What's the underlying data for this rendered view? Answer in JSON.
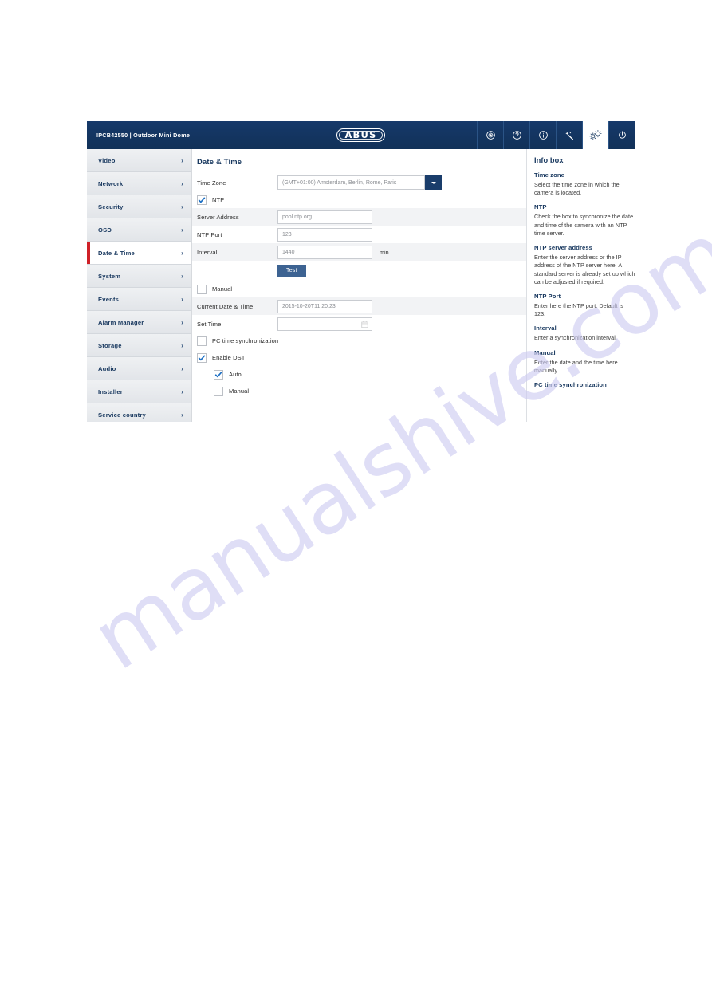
{
  "header": {
    "device_model": "IPCB42550",
    "device_name": "Outdoor Mini Dome",
    "device_title": "IPCB42550  |  Outdoor Mini Dome",
    "logo_text": "ABUS",
    "toolbar": [
      {
        "name": "live-view-icon",
        "label": "Live view"
      },
      {
        "name": "help-icon",
        "label": "Help"
      },
      {
        "name": "info-icon",
        "label": "Info"
      },
      {
        "name": "assistant-wand-icon",
        "label": "Assistant"
      },
      {
        "name": "settings-gear-icon",
        "label": "Settings",
        "active": true
      },
      {
        "name": "power-icon",
        "label": "Power"
      }
    ]
  },
  "sidebar": {
    "items": [
      {
        "label": "Video",
        "selected": false
      },
      {
        "label": "Network",
        "selected": false
      },
      {
        "label": "Security",
        "selected": false
      },
      {
        "label": "OSD",
        "selected": false
      },
      {
        "label": "Date & Time",
        "selected": true
      },
      {
        "label": "System",
        "selected": false
      },
      {
        "label": "Events",
        "selected": false
      },
      {
        "label": "Alarm Manager",
        "selected": false
      },
      {
        "label": "Storage",
        "selected": false
      },
      {
        "label": "Audio",
        "selected": false
      },
      {
        "label": "Installer",
        "selected": false
      },
      {
        "label": "Service country",
        "selected": false
      }
    ],
    "chevron": "›"
  },
  "main": {
    "page_title": "Date & Time",
    "time_zone": {
      "label": "Time Zone",
      "value": "(GMT+01:00) Amsterdam, Berlin, Rome, Paris"
    },
    "ntp_checkbox": {
      "label": "NTP",
      "checked": true
    },
    "server_address": {
      "label": "Server Address",
      "value": "pool.ntp.org"
    },
    "ntp_port": {
      "label": "NTP Port",
      "value": "123"
    },
    "interval": {
      "label": "Interval",
      "value": "1440",
      "unit": "min."
    },
    "test_button": {
      "label": "Test"
    },
    "manual_checkbox": {
      "label": "Manual",
      "checked": false
    },
    "current_date_time": {
      "label": "Current Date & Time",
      "value": "2015-10-20T11:20:23"
    },
    "set_time": {
      "label": "Set Time",
      "value": ""
    },
    "pc_time_sync": {
      "label": "PC time synchronization",
      "checked": false
    },
    "enable_dst": {
      "label": "Enable DST",
      "checked": true
    },
    "dst_auto": {
      "label": "Auto",
      "checked": true
    },
    "dst_manual": {
      "label": "Manual",
      "checked": false
    }
  },
  "infobox": {
    "title": "Info box",
    "sections": [
      {
        "heading": "Time zone",
        "text": "Select the time zone in which the camera is located."
      },
      {
        "heading": "NTP",
        "text": "Check the box to synchronize the date and time of the camera with an NTP time server."
      },
      {
        "heading": "NTP server address",
        "text": "Enter the server address or the IP address of the NTP server here. A standard server is already set up which can be adjusted if required."
      },
      {
        "heading": "NTP Port",
        "text": "Enter here the NTP port. Default is 123."
      },
      {
        "heading": "Interval",
        "text": "Enter a synchronization interval."
      },
      {
        "heading": "Manual",
        "text": "Enter the date and the time here manually."
      },
      {
        "heading": "PC time synchronization",
        "text": ""
      }
    ]
  },
  "watermark": {
    "text": "manualshive.com"
  },
  "colors": {
    "header_blue": "#143966",
    "accent_red": "#cf2027",
    "title_navy": "#17375e",
    "button_blue": "#3d6392",
    "sidebar_gray": "#e7e9ec"
  }
}
